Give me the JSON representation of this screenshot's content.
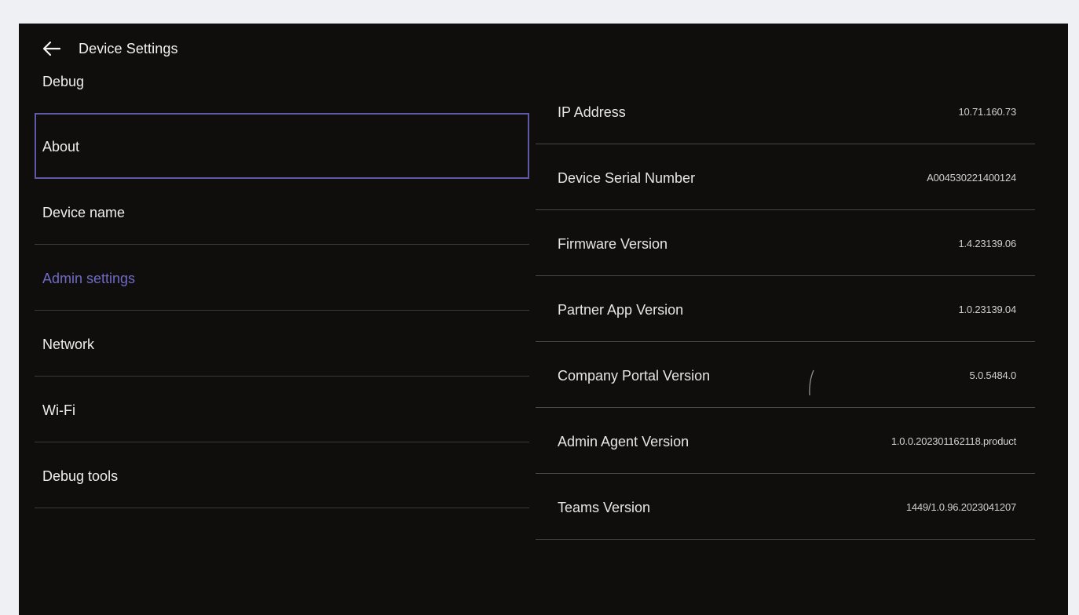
{
  "header": {
    "title": "Device Settings",
    "back_icon": "arrow-left-icon"
  },
  "nav": {
    "items": [
      {
        "label": "Debug"
      },
      {
        "label": "About"
      },
      {
        "label": "Device name"
      },
      {
        "label": "Admin settings"
      },
      {
        "label": "Network"
      },
      {
        "label": "Wi-Fi"
      },
      {
        "label": "Debug tools"
      }
    ],
    "focused": "About",
    "selected": "Admin settings"
  },
  "info": {
    "rows": [
      {
        "key": "IP Address",
        "value": "10.71.160.73"
      },
      {
        "key": "Device Serial Number",
        "value": "A004530221400124"
      },
      {
        "key": "Firmware Version",
        "value": "1.4.23139.06"
      },
      {
        "key": "Partner App Version",
        "value": "1.0.23139.04"
      },
      {
        "key": "Company Portal Version",
        "value": "5.0.5484.0"
      },
      {
        "key": "Admin Agent Version",
        "value": "1.0.0.202301162118.product"
      },
      {
        "key": "Teams Version",
        "value": "1449/1.0.96.2023041207"
      }
    ]
  },
  "colors": {
    "background": "#0f0e0c",
    "accent": "#6f6bc4",
    "focus_border": "#5e5aa8",
    "divider": "#3b3a38"
  }
}
